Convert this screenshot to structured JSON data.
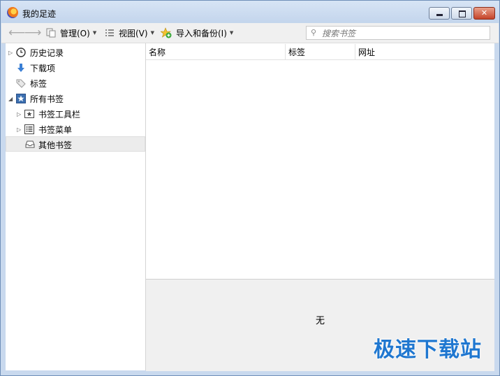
{
  "window": {
    "title": "我的足迹"
  },
  "toolbar": {
    "manage_label": "管理(O)",
    "view_label": "视图(V)",
    "import_label": "导入和备份(I)",
    "search_placeholder": "搜索书签"
  },
  "sidebar": {
    "items": [
      {
        "label": "历史记录",
        "icon": "clock-icon"
      },
      {
        "label": "下载项",
        "icon": "download-arrow-icon"
      },
      {
        "label": "标签",
        "icon": "tag-icon"
      },
      {
        "label": "所有书签",
        "icon": "bookmarks-star-icon"
      },
      {
        "label": "书签工具栏",
        "icon": "toolbar-star-icon"
      },
      {
        "label": "书签菜单",
        "icon": "menu-list-icon"
      },
      {
        "label": "其他书签",
        "icon": "inbox-tray-icon"
      }
    ]
  },
  "table": {
    "columns": [
      "名称",
      "标签",
      "网址"
    ]
  },
  "detail": {
    "text": "无"
  },
  "watermark": {
    "text": "极速下载站"
  },
  "colors": {
    "watermark": "#1f77d0",
    "accent": "#3a7fd5"
  }
}
